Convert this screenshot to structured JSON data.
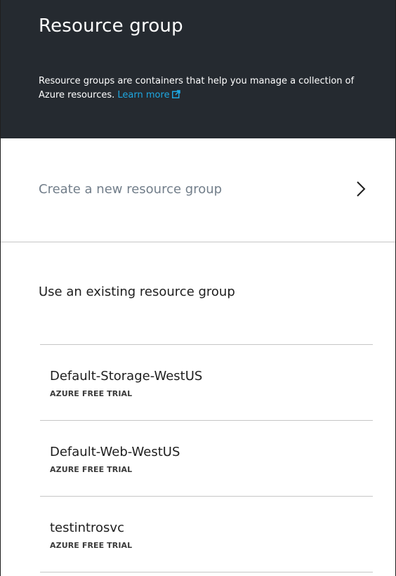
{
  "header": {
    "title": "Resource group",
    "description": "Resource groups are containers that help you manage a collection of Azure resources.",
    "learn_more": "Learn more",
    "accent_color": "#1ea7e1",
    "background_color": "#252a30"
  },
  "create": {
    "label": "Create a new resource group",
    "icon": "chevron-right-icon"
  },
  "existing": {
    "heading": "Use an existing resource group",
    "items": [
      {
        "name": "Default-Storage-WestUS",
        "subscription": "AZURE FREE TRIAL"
      },
      {
        "name": "Default-Web-WestUS",
        "subscription": "AZURE FREE TRIAL"
      },
      {
        "name": "testintrosvc",
        "subscription": "AZURE FREE TRIAL"
      }
    ]
  }
}
